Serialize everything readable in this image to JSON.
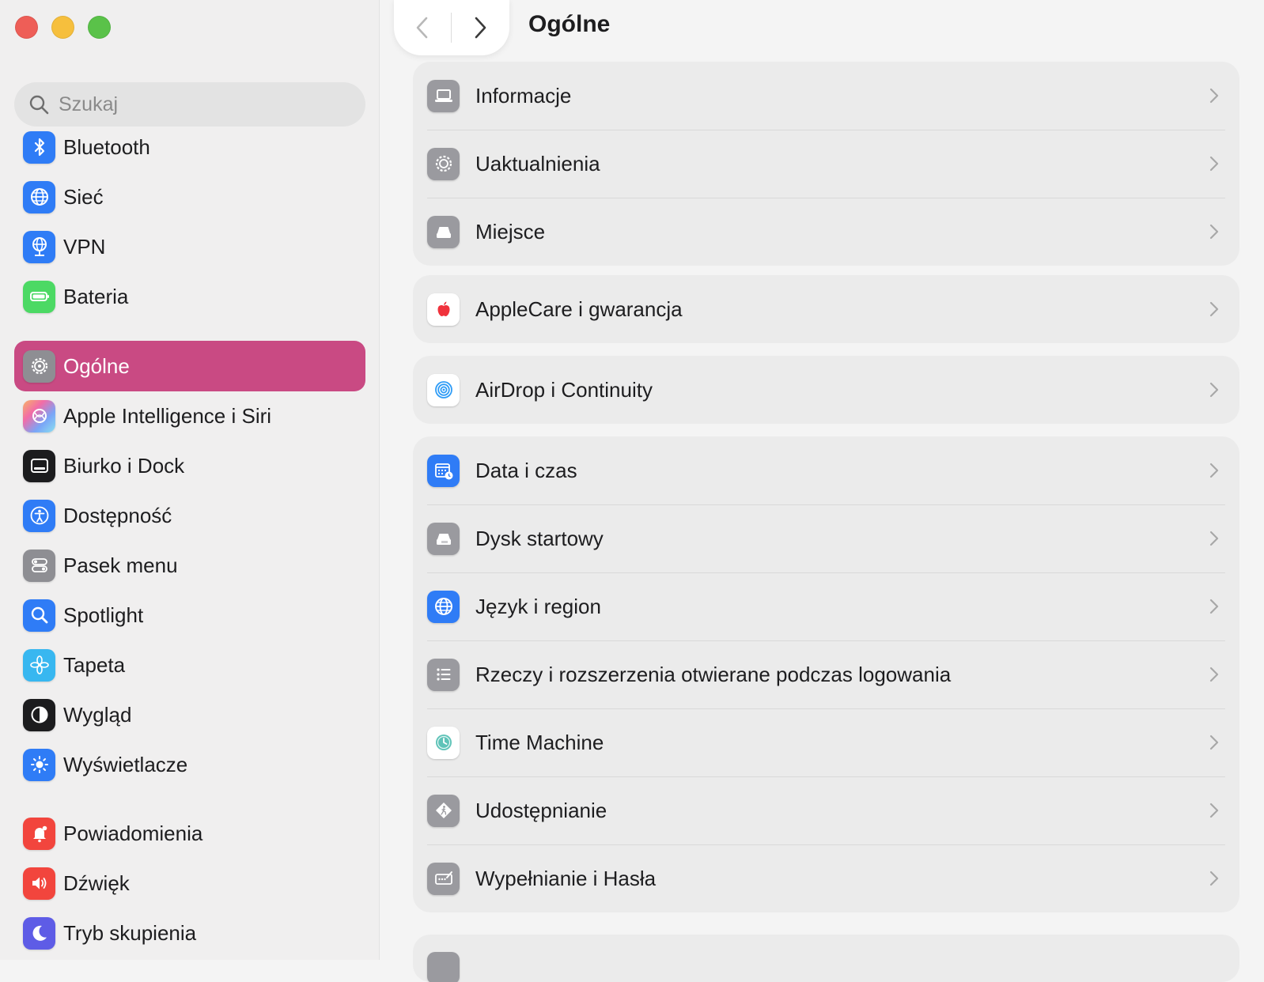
{
  "window": {
    "title": "Ogólne"
  },
  "search": {
    "placeholder": "Szukaj"
  },
  "sidebar": {
    "items": [
      {
        "label": "Bluetooth",
        "icon": "bluetooth-icon",
        "color": "#2f7cf6"
      },
      {
        "label": "Sieć",
        "icon": "globe-icon",
        "color": "#2f7cf6"
      },
      {
        "label": "VPN",
        "icon": "vpn-globe-icon",
        "color": "#2f7cf6"
      },
      {
        "label": "Bateria",
        "icon": "battery-icon",
        "color": "#4cd964"
      },
      {
        "label": "Ogólne",
        "icon": "gear-icon",
        "color": "#8e8e93",
        "active": true
      },
      {
        "label": "Apple Intelligence i Siri",
        "icon": "siri-icon",
        "color": "#f4a0d0"
      },
      {
        "label": "Biurko i Dock",
        "icon": "dock-icon",
        "color": "#1c1c1e"
      },
      {
        "label": "Dostępność",
        "icon": "accessibility-icon",
        "color": "#2f7cf6"
      },
      {
        "label": "Pasek menu",
        "icon": "menubar-icon",
        "color": "#8e8e93"
      },
      {
        "label": "Spotlight",
        "icon": "spotlight-icon",
        "color": "#2f7cf6"
      },
      {
        "label": "Tapeta",
        "icon": "wallpaper-icon",
        "color": "#38b7f0"
      },
      {
        "label": "Wygląd",
        "icon": "appearance-icon",
        "color": "#1c1c1e"
      },
      {
        "label": "Wyświetlacze",
        "icon": "display-icon",
        "color": "#2f7cf6"
      },
      {
        "label": "Powiadomienia",
        "icon": "bell-icon",
        "color": "#f2453d"
      },
      {
        "label": "Dźwięk",
        "icon": "speaker-icon",
        "color": "#f2453d"
      },
      {
        "label": "Tryb skupienia",
        "icon": "moon-icon",
        "color": "#5e5ce6"
      }
    ]
  },
  "main": {
    "groups": [
      {
        "rows": [
          {
            "label": "Informacje",
            "icon": "laptop-icon"
          },
          {
            "label": "Uaktualnienia",
            "icon": "software-update-icon"
          },
          {
            "label": "Miejsce",
            "icon": "storage-icon"
          }
        ]
      },
      {
        "rows": [
          {
            "label": "AppleCare i gwarancja",
            "icon": "apple-logo-icon"
          }
        ]
      },
      {
        "rows": [
          {
            "label": "AirDrop i Continuity",
            "icon": "airdrop-icon"
          }
        ]
      },
      {
        "rows": [
          {
            "label": "Data i czas",
            "icon": "calendar-clock-icon"
          },
          {
            "label": "Dysk startowy",
            "icon": "startup-disk-icon"
          },
          {
            "label": "Język i region",
            "icon": "language-globe-icon"
          },
          {
            "label": "Rzeczy i rozszerzenia otwierane podczas logowania",
            "icon": "list-icon"
          },
          {
            "label": "Time Machine",
            "icon": "time-machine-icon"
          },
          {
            "label": "Udostępnianie",
            "icon": "sharing-icon"
          },
          {
            "label": "Wypełnianie i Hasła",
            "icon": "autofill-icon"
          }
        ]
      }
    ]
  }
}
